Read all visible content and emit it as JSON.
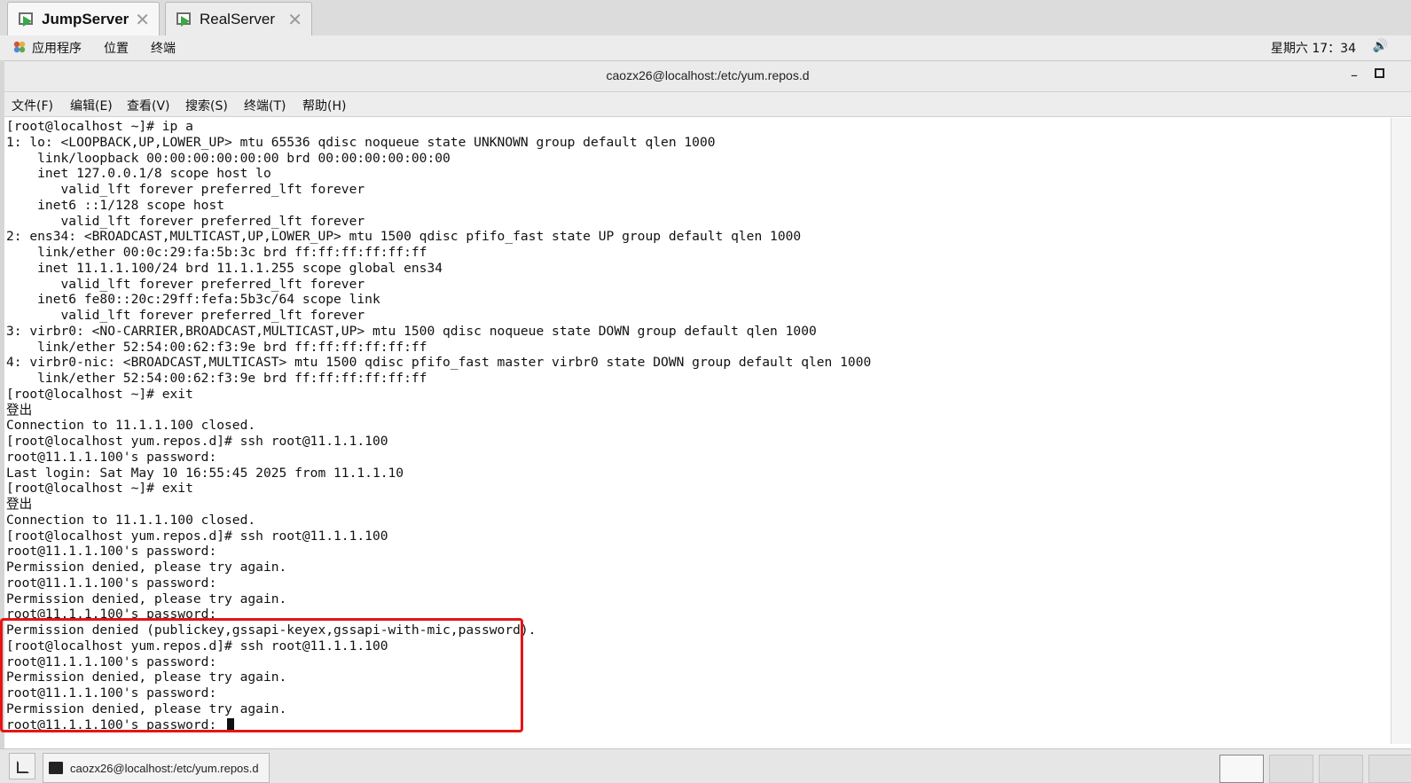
{
  "tabs": [
    {
      "label": "JumpServer",
      "active": true
    },
    {
      "label": "RealServer",
      "active": false
    }
  ],
  "panel": {
    "menus": [
      "应用程序",
      "位置",
      "终端"
    ],
    "clock": "星期六 17：34",
    "volume_icon": "speaker-icon"
  },
  "window": {
    "title": "caozx26@localhost:/etc/yum.repos.d"
  },
  "menubar": [
    "文件(F)",
    "编辑(E)",
    "查看(V)",
    "搜索(S)",
    "终端(T)",
    "帮助(H)"
  ],
  "terminal": {
    "lines": [
      "[root@localhost ~]# ip a",
      "1: lo: <LOOPBACK,UP,LOWER_UP> mtu 65536 qdisc noqueue state UNKNOWN group default qlen 1000",
      "    link/loopback 00:00:00:00:00:00 brd 00:00:00:00:00:00",
      "    inet 127.0.0.1/8 scope host lo",
      "       valid_lft forever preferred_lft forever",
      "    inet6 ::1/128 scope host",
      "       valid_lft forever preferred_lft forever",
      "2: ens34: <BROADCAST,MULTICAST,UP,LOWER_UP> mtu 1500 qdisc pfifo_fast state UP group default qlen 1000",
      "    link/ether 00:0c:29:fa:5b:3c brd ff:ff:ff:ff:ff:ff",
      "    inet 11.1.1.100/24 brd 11.1.1.255 scope global ens34",
      "       valid_lft forever preferred_lft forever",
      "    inet6 fe80::20c:29ff:fefa:5b3c/64 scope link",
      "       valid_lft forever preferred_lft forever",
      "3: virbr0: <NO-CARRIER,BROADCAST,MULTICAST,UP> mtu 1500 qdisc noqueue state DOWN group default qlen 1000",
      "    link/ether 52:54:00:62:f3:9e brd ff:ff:ff:ff:ff:ff",
      "4: virbr0-nic: <BROADCAST,MULTICAST> mtu 1500 qdisc pfifo_fast master virbr0 state DOWN group default qlen 1000",
      "    link/ether 52:54:00:62:f3:9e brd ff:ff:ff:ff:ff:ff",
      "[root@localhost ~]# exit",
      "登出",
      "Connection to 11.1.1.100 closed.",
      "[root@localhost yum.repos.d]# ssh root@11.1.1.100",
      "root@11.1.1.100's password:",
      "Last login: Sat May 10 16:55:45 2025 from 11.1.1.10",
      "[root@localhost ~]# exit",
      "登出",
      "Connection to 11.1.1.100 closed.",
      "[root@localhost yum.repos.d]# ssh root@11.1.1.100",
      "root@11.1.1.100's password:",
      "Permission denied, please try again.",
      "root@11.1.1.100's password:",
      "Permission denied, please try again.",
      "root@11.1.1.100's password:",
      "Permission denied (publickey,gssapi-keyex,gssapi-with-mic,password).",
      "[root@localhost yum.repos.d]# ssh root@11.1.1.100",
      "root@11.1.1.100's password:",
      "Permission denied, please try again.",
      "root@11.1.1.100's password:",
      "Permission denied, please try again.",
      "root@11.1.1.100's password: "
    ]
  },
  "taskbar": {
    "task_label": "caozx26@localhost:/etc/yum.repos.d",
    "workspaces": 4
  }
}
